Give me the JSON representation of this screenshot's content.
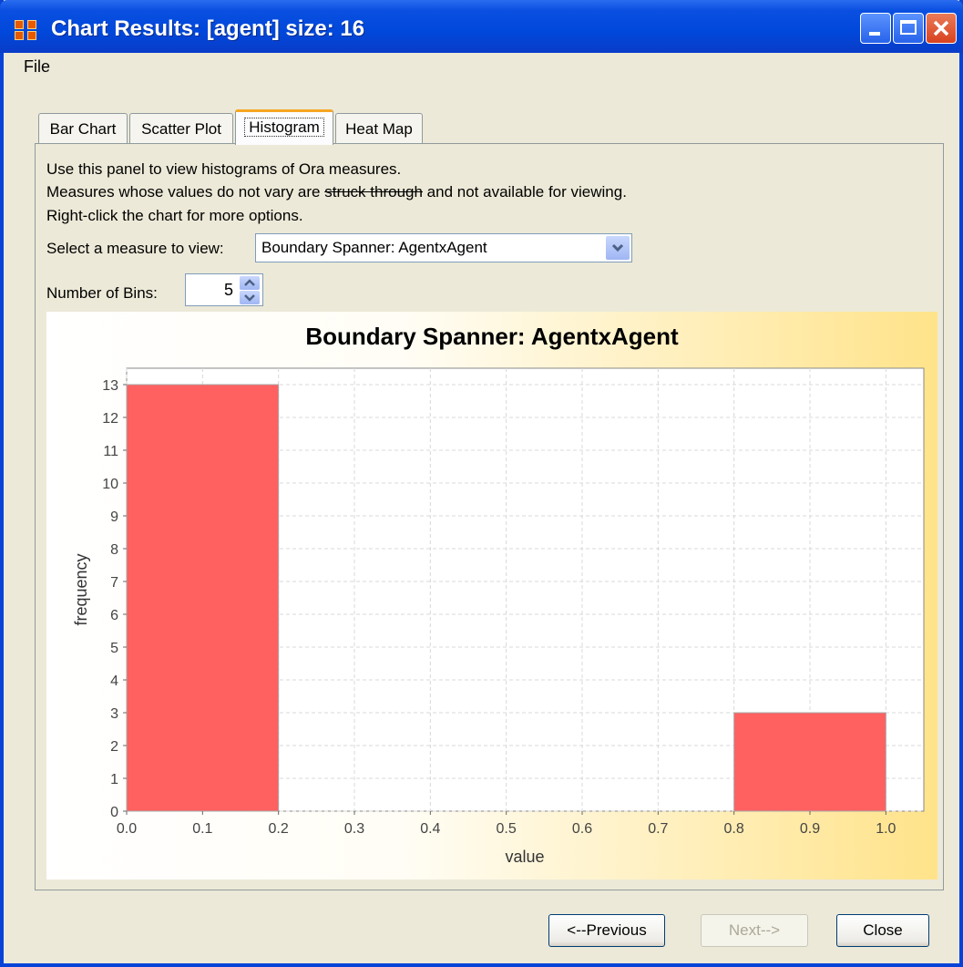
{
  "window": {
    "title": "Chart Results: [agent] size: 16"
  },
  "menu": {
    "file": "File"
  },
  "tabs": [
    {
      "label": "Bar Chart"
    },
    {
      "label": "Scatter Plot"
    },
    {
      "label": "Histogram"
    },
    {
      "label": "Heat Map"
    }
  ],
  "panel": {
    "line1": "Use this panel to view histograms of Ora measures.",
    "line2_pre": "Measures whose values do not vary are ",
    "line2_struck": "struck through",
    "line2_post": " and not available for viewing.",
    "line3": "Right-click the chart for more options.",
    "measure_label": "Select a measure to view:",
    "measure_value": "Boundary Spanner: AgentxAgent",
    "bins_label": "Number of Bins:",
    "bins_value": "5"
  },
  "chart_data": {
    "type": "bar",
    "title": "Boundary Spanner: AgentxAgent",
    "xlabel": "value",
    "ylabel": "frequency",
    "xlim": [
      0.0,
      1.05
    ],
    "ylim": [
      0,
      13.5
    ],
    "x_ticks": [
      "0.0",
      "0.1",
      "0.2",
      "0.3",
      "0.4",
      "0.5",
      "0.6",
      "0.7",
      "0.8",
      "0.9",
      "1.0"
    ],
    "y_ticks": [
      "0",
      "1",
      "2",
      "3",
      "4",
      "5",
      "6",
      "7",
      "8",
      "9",
      "10",
      "11",
      "12",
      "13"
    ],
    "bins": [
      {
        "start": 0.0,
        "end": 0.2,
        "value": 13
      },
      {
        "start": 0.2,
        "end": 0.4,
        "value": 0
      },
      {
        "start": 0.4,
        "end": 0.6,
        "value": 0
      },
      {
        "start": 0.6,
        "end": 0.8,
        "value": 0
      },
      {
        "start": 0.8,
        "end": 1.0,
        "value": 3
      }
    ],
    "bar_color": "#ff6060",
    "grid": true
  },
  "buttons": {
    "previous": "<--Previous",
    "next": "Next-->",
    "close": "Close"
  }
}
